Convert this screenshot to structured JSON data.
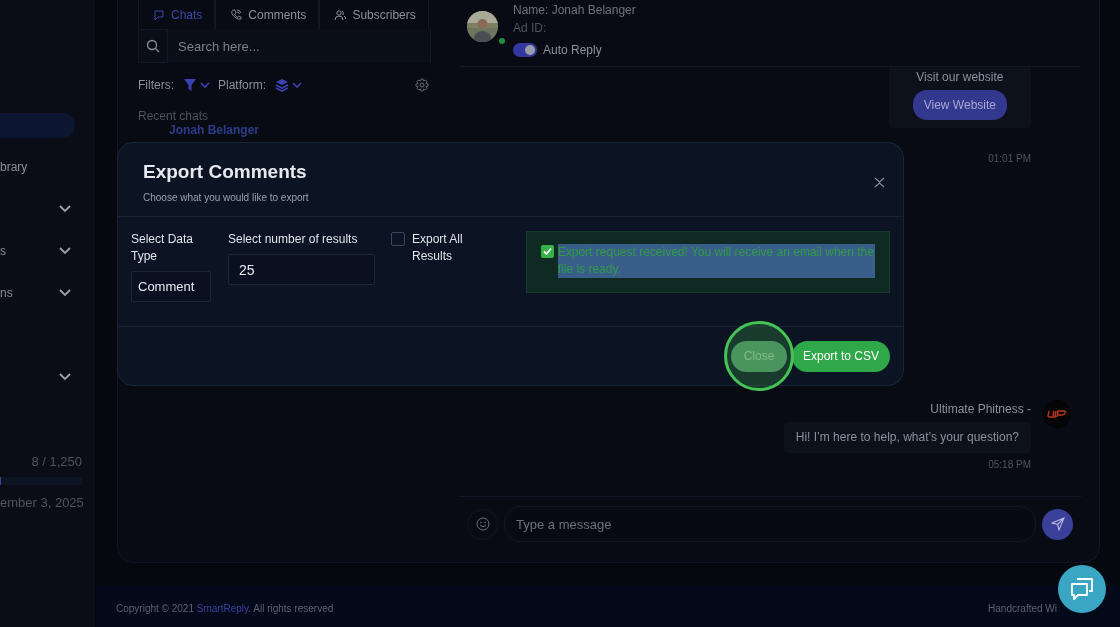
{
  "sidebar": {
    "items": [
      {
        "selected": true
      },
      {
        "label": "brary",
        "selected": false
      },
      {
        "selected": false,
        "expanded": false
      },
      {
        "label": "s",
        "selected": false,
        "expanded": false
      },
      {
        "label": "ns",
        "selected": false,
        "expanded": false
      },
      {
        "selected": false
      },
      {
        "selected": false,
        "expanded": false
      }
    ],
    "usage": {
      "reading": "8 / 1,250",
      "level": 0.0064
    },
    "date": "ember 3, 2025"
  },
  "tabs": [
    {
      "label": "Chats",
      "selected": true
    },
    {
      "label": "Comments",
      "selected": false
    },
    {
      "label": "Subscribers",
      "selected": false
    }
  ],
  "search": {
    "placeholder": "Search here..."
  },
  "filters": {
    "label": "Filters:",
    "platform_label": "Platform:"
  },
  "recent_label": "Recent chats",
  "chats": [
    {
      "name": "Jonah Belanger"
    }
  ],
  "chat_header": {
    "name": "Name: Jonah Belanger",
    "ad_id": "Ad ID:",
    "online": true,
    "auto_reply": {
      "label": "Auto Reply",
      "on": true
    }
  },
  "messages": [
    {
      "kind": "buttons",
      "text": "Visit our website",
      "button": "View Website",
      "time": "01:01 PM"
    },
    {
      "kind": "text",
      "sender": "Ultimate Phitness -",
      "text": "Hi! I’m here to help, what’s your question?",
      "time": "05:18 PM"
    }
  ],
  "composer": {
    "placeholder": "Type a message"
  },
  "footer": {
    "copyright": "Copyright © 2021 ",
    "link": "SmartReply",
    "rest": ". All rights reserved",
    "right": "Handcrafted Wi"
  },
  "modal": {
    "title": "Export Comments",
    "subtitle": "Choose what you would like to export",
    "data_type": {
      "label": "Select Data Type",
      "value": "Comment"
    },
    "count": {
      "label": "Select number of results",
      "value": "25"
    },
    "export_all": {
      "label": "Export All Results",
      "checked": false
    },
    "notice": {
      "text": "Export request received! You will receive an email when the file is ready.",
      "highlighted": true
    },
    "buttons": [
      {
        "label": "Close",
        "kind": "secondary",
        "focused": true
      },
      {
        "label": "Export to CSV",
        "kind": "primary",
        "focused": false
      }
    ]
  }
}
